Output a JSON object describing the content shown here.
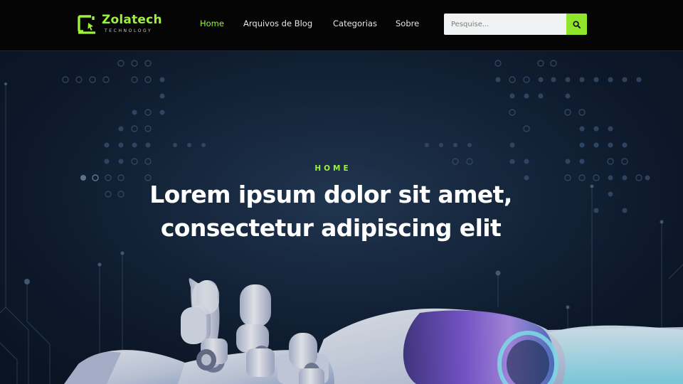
{
  "brand": {
    "name": "Zolatech",
    "tagline": "TECHNOLOGY",
    "accent_color": "#9cf23a"
  },
  "nav": {
    "items": [
      {
        "label": "Home",
        "active": true
      },
      {
        "label": "Arquivos de Blog",
        "active": false
      },
      {
        "label": "Categorias",
        "active": false
      },
      {
        "label": "Sobre",
        "active": false
      }
    ]
  },
  "search": {
    "placeholder": "Pesquise...",
    "value": "",
    "button_icon": "search-icon"
  },
  "hero": {
    "eyebrow": "HOME",
    "title_line1": "Lorem ipsum dolor sit amet,",
    "title_line2": "consectetur adipiscing elit",
    "background": "robot-hand-circuit-image"
  }
}
